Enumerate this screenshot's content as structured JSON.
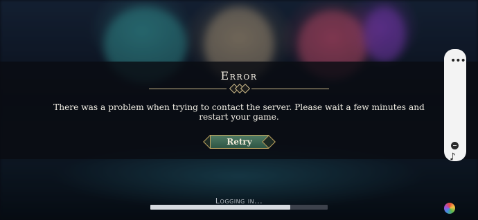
{
  "dialog": {
    "title": "Error",
    "message": "There was a problem when trying to contact the server. Please wait a few minutes and restart your game.",
    "retry_label": "Retry"
  },
  "loading": {
    "label": "Logging in...",
    "progress": 0.79
  },
  "side_panel": {
    "more_icon": "more-icon",
    "minimize_icon": "minus-icon",
    "music_icon": "music-icon"
  },
  "corner_icon": "color-wheel-icon",
  "colors": {
    "retry_bg": "#3f6a55",
    "gold_trim": "#c3a660",
    "band": "#0a0c12"
  }
}
